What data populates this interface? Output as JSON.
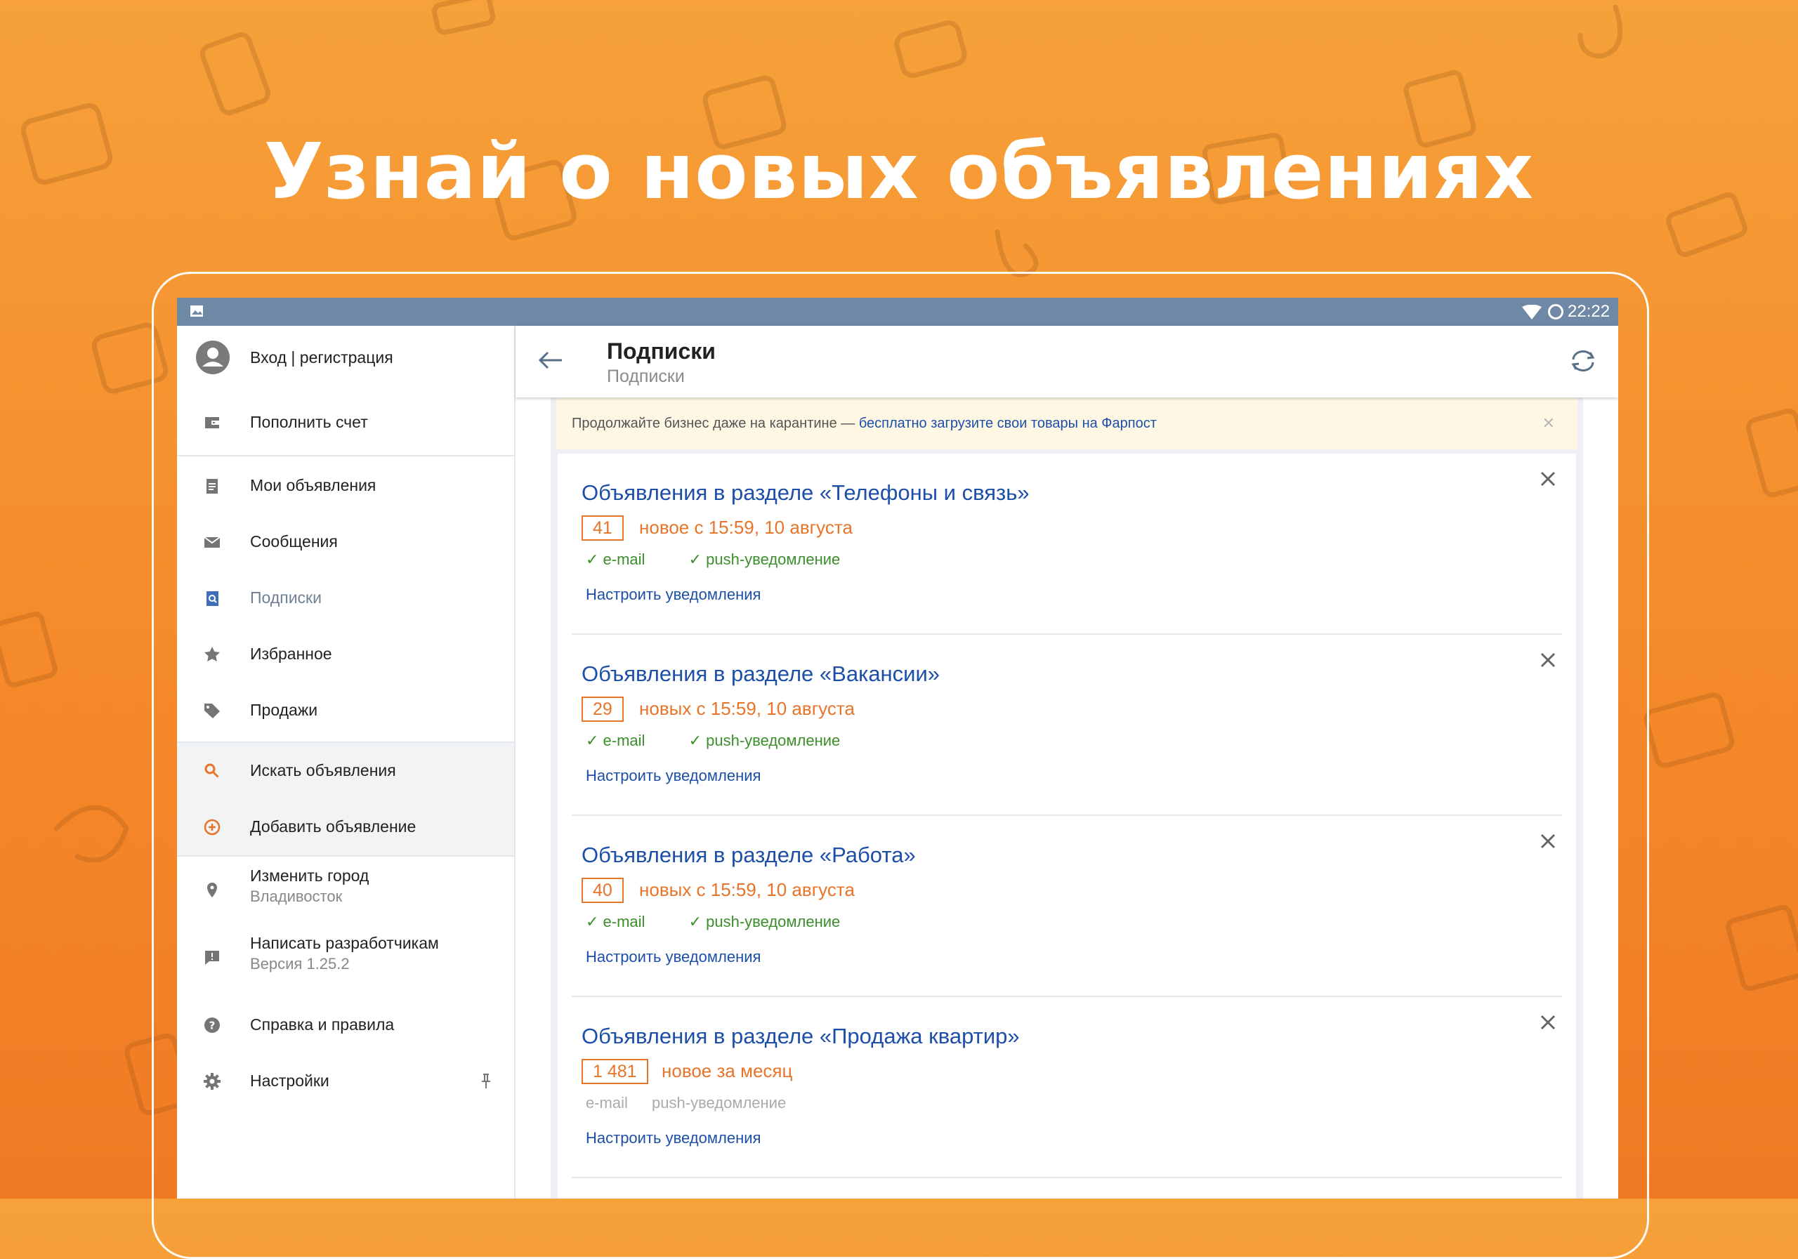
{
  "headline": "Узнай о новых объявлениях",
  "status_bar": {
    "time": "22:22"
  },
  "sidebar": {
    "login": "Вход | регистрация",
    "items": [
      {
        "label": "Пополнить счет",
        "icon": "wallet-icon"
      },
      {
        "label": "Мои объявления",
        "icon": "clipboard-icon"
      },
      {
        "label": "Сообщения",
        "icon": "mail-icon"
      },
      {
        "label": "Подписки",
        "icon": "subscriptions-icon",
        "active": true
      },
      {
        "label": "Избранное",
        "icon": "star-icon"
      },
      {
        "label": "Продажи",
        "icon": "tag-icon"
      },
      {
        "label": "Искать объявления",
        "icon": "search-icon"
      },
      {
        "label": "Добавить объявление",
        "icon": "add-circle-icon"
      }
    ],
    "city": {
      "label": "Изменить город",
      "value": "Владивосток"
    },
    "feedback": {
      "label": "Написать разработчикам",
      "version": "Версия 1.25.2"
    },
    "help": "Справка и правила",
    "settings": "Настройки"
  },
  "appbar": {
    "title": "Подписки",
    "subtitle": "Подписки"
  },
  "banner": {
    "text": "Продолжайте бизнес даже на карантине — ",
    "link": "бесплатно загрузите свои товары на Фарпост"
  },
  "subscriptions": [
    {
      "title": "Объявления в разделе «Телефоны и связь»",
      "count": "41",
      "new_text": "новое с 15:59, 10 августа",
      "email": "e-mail",
      "push": "push-уведомление",
      "enabled": true,
      "configure": "Настроить уведомления"
    },
    {
      "title": "Объявления в разделе «Вакансии»",
      "count": "29",
      "new_text": "новых с 15:59, 10 августа",
      "email": "e-mail",
      "push": "push-уведомление",
      "enabled": true,
      "configure": "Настроить уведомления"
    },
    {
      "title": "Объявления в разделе «Работа»",
      "count": "40",
      "new_text": "новых с 15:59, 10 августа",
      "email": "e-mail",
      "push": "push-уведомление",
      "enabled": true,
      "configure": "Настроить уведомления"
    },
    {
      "title": "Объявления в разделе «Продажа квартир»",
      "count": "1 481",
      "new_text": "новое за месяц",
      "email": "e-mail",
      "push": "push-уведомление",
      "enabled": false,
      "configure": "Настроить уведомления"
    }
  ],
  "colors": {
    "accent": "#e8742a",
    "link": "#1d4fa8",
    "statusbar": "#6f88a5",
    "enabled": "#3c8f2c"
  }
}
